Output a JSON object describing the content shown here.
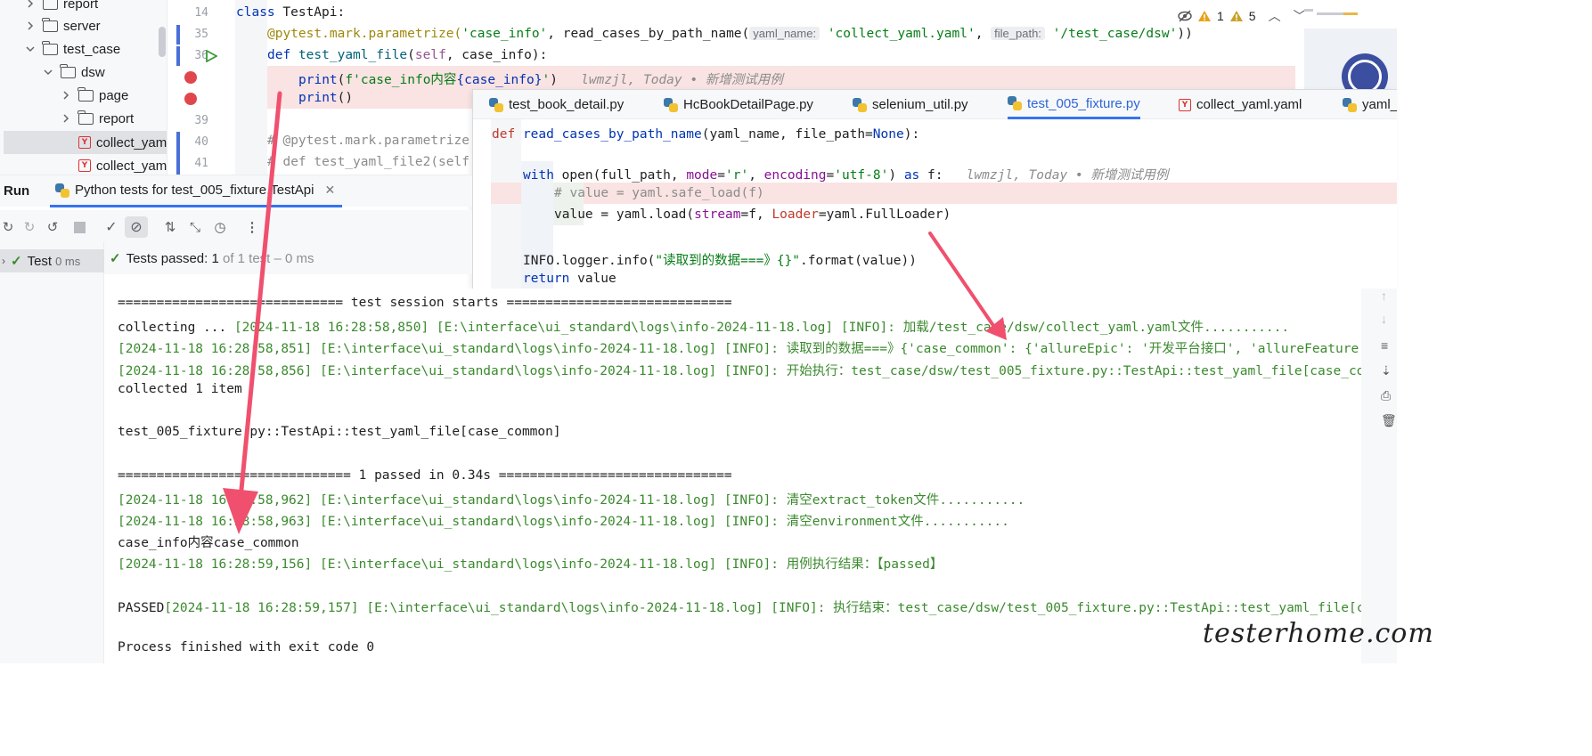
{
  "project_tree": {
    "items": [
      {
        "label": "report",
        "depth": 1,
        "state": "collapsed",
        "kind": "folder"
      },
      {
        "label": "server",
        "depth": 1,
        "state": "collapsed",
        "kind": "folder"
      },
      {
        "label": "test_case",
        "depth": 1,
        "state": "expanded",
        "kind": "folder"
      },
      {
        "label": "dsw",
        "depth": 2,
        "state": "expanded",
        "kind": "folder"
      },
      {
        "label": "page",
        "depth": 3,
        "state": "collapsed",
        "kind": "folder"
      },
      {
        "label": "report",
        "depth": 3,
        "state": "collapsed",
        "kind": "folder"
      },
      {
        "label": "collect_yam",
        "depth": 3,
        "state": "none",
        "kind": "yaml",
        "selected": true
      },
      {
        "label": "collect_yam",
        "depth": 3,
        "state": "none",
        "kind": "yaml"
      }
    ]
  },
  "editor": {
    "line_numbers": [
      "14",
      "35",
      "36",
      "",
      "",
      "39",
      "40",
      "41"
    ],
    "line14": {
      "kw": "class",
      "name": "TestApi:"
    },
    "line35": {
      "decorator": "@pytest.mark.parametrize(",
      "arg1": "'case_info'",
      "mid": ", read_cases_by_path_name(",
      "hint1": "yaml_name:",
      "arg2": "'collect_yaml.yaml'",
      "comma": ", ",
      "hint2": "file_path:",
      "arg3": "'/test_case/dsw'",
      "end": "))"
    },
    "line36": {
      "kw": "def",
      "fn": "test_yaml_file",
      "open": "(",
      "self": "self",
      "rest": ", case_info):"
    },
    "line37": {
      "fn": "print",
      "open": "(",
      "fstr": "f'case_info内容",
      "brace": "{case_info}",
      "end_str": "'",
      "close": ")",
      "blame": "lwmzjl, Today • 新增测试用例"
    },
    "line38": {
      "fn": "print",
      "rest": "()"
    },
    "line40": "# @pytest.mark.parametrize",
    "line41": "# def test_yaml_file2(self",
    "inspections": {
      "warnings": "1",
      "weak_warnings": "5"
    }
  },
  "overlay": {
    "tabs": [
      {
        "label": "test_book_detail.py",
        "kind": "py"
      },
      {
        "label": "HcBookDetailPage.py",
        "kind": "py"
      },
      {
        "label": "selenium_util.py",
        "kind": "py"
      },
      {
        "label": "test_005_fixture.py",
        "kind": "py",
        "active": true
      },
      {
        "label": "collect_yaml.yaml",
        "kind": "yaml"
      },
      {
        "label": "yaml_",
        "kind": "py"
      }
    ],
    "def_line": {
      "kw": "def",
      "fn": "read_cases_by_path_name",
      "rest": "(yaml_name, file_path=",
      "none": "None",
      "end": "):"
    },
    "with_line": {
      "kw": "with",
      "a": " open(full_path, ",
      "p1": "mode",
      "b": "=",
      "s1": "'r'",
      "c": ", ",
      "p2": "encoding",
      "d": "=",
      "s2": "'utf-8'",
      "e": ") ",
      "as": "as",
      "f": " f:",
      "blame": "lwmzjl, Today • 新增测试用例"
    },
    "comment_line": "# value = yaml.safe_load(f)",
    "load_line": {
      "a": "value = yaml.load(",
      "p1": "stream",
      "b": "=f, ",
      "p2": "Loader",
      "c": "=yaml.FullLoader)"
    },
    "log_line": {
      "a": "INFO.logger.info(",
      "s": "\"读取到的数据===》{}\"",
      "b": ".format(value))"
    },
    "return_line": {
      "kw": "return",
      "rest": " value"
    }
  },
  "run": {
    "title": "Run",
    "config_tab": "Python tests for test_005_fixture.TestApi",
    "tree_item": "Test",
    "tree_time": "0 ms",
    "status": {
      "prefix": "Tests passed:",
      "count": "1",
      "rest": "of 1 test – 0 ms"
    }
  },
  "console": {
    "lines": [
      {
        "text": "============================= test session starts =============================",
        "color": "dark"
      },
      {
        "text": "collecting ... ",
        "color": "dark",
        "tail": "[2024-11-18 16:28:58,850] [E:\\interface\\ui_standard\\logs\\info-2024-11-18.log] [INFO]: 加载/test_case/dsw/collect_yaml.yaml文件..........."
      },
      {
        "text": "[2024-11-18 16:28:58,851] [E:\\interface\\ui_standard\\logs\\info-2024-11-18.log] [INFO]: 读取到的数据===》{'case_common': {'allureEpic': '开发平台接口', 'allureFeature':",
        "color": "green"
      },
      {
        "text": "[2024-11-18 16:28:58,856] [E:\\interface\\ui_standard\\logs\\info-2024-11-18.log] [INFO]: 开始执行：test_case/dsw/test_005_fixture.py::TestApi::test_yaml_file[case_com",
        "color": "green"
      },
      {
        "text": "collected 1 item",
        "color": "dark"
      },
      {
        "text": "",
        "color": "dark"
      },
      {
        "text": "test_005_fixture.py::TestApi::test_yaml_file[case_common]",
        "color": "dark"
      },
      {
        "text": "",
        "color": "dark"
      },
      {
        "text": "============================== 1 passed in 0.34s ==============================",
        "color": "dark"
      },
      {
        "text": "[2024-11-18 16:28:58,962] [E:\\interface\\ui_standard\\logs\\info-2024-11-18.log] [INFO]: 清空extract_token文件...........",
        "color": "green"
      },
      {
        "text": "[2024-11-18 16:28:58,963] [E:\\interface\\ui_standard\\logs\\info-2024-11-18.log] [INFO]: 清空environment文件...........",
        "color": "green"
      },
      {
        "text": "case_info内容case_common",
        "color": "dark"
      },
      {
        "text": "[2024-11-18 16:28:59,156] [E:\\interface\\ui_standard\\logs\\info-2024-11-18.log] [INFO]: 用例执行结果：【passed】",
        "color": "green"
      },
      {
        "text": "",
        "color": "dark"
      },
      {
        "text": "PASSED",
        "color": "dark",
        "tail": "[2024-11-18 16:28:59,157] [E:\\interface\\ui_standard\\logs\\info-2024-11-18.log] [INFO]: 执行结束：test_case/dsw/test_005_fixture.py::TestApi::test_yaml_file[ca"
      },
      {
        "text": "",
        "color": "dark"
      },
      {
        "text": "Process finished with exit code 0",
        "color": "dark"
      }
    ]
  },
  "watermark": "testerhome.com",
  "colors": {
    "arrow": "#f0506e",
    "pass_green": "#3b8a2e",
    "breakpoint": "#e0474d",
    "keyword": "#0033b3"
  }
}
